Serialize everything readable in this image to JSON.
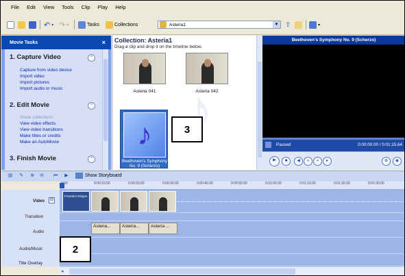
{
  "menu": [
    "File",
    "Edit",
    "View",
    "Tools",
    "Clip",
    "Play",
    "Help"
  ],
  "toolbar": {
    "tasks_label": "Tasks",
    "collections_label": "Collections",
    "collection_value": "Asteria1"
  },
  "tasks_pane": {
    "title": "Movie Tasks",
    "close": "×",
    "sections": [
      {
        "title": "1. Capture Video",
        "links": [
          "Capture from video device",
          "Import video",
          "Import pictures",
          "Import audio or music"
        ]
      },
      {
        "title": "2. Edit Movie",
        "links": [
          "Show collections",
          "View video effects",
          "View video transitions",
          "Make titles or credits",
          "Make an AutoMovie"
        ]
      },
      {
        "title": "3. Finish Movie",
        "links": []
      }
    ]
  },
  "collection": {
    "title": "Collection: Asteria1",
    "instructions": "Drag a clip and drop it on the timeline below.",
    "clips": [
      {
        "caption": "Asteria 041"
      },
      {
        "caption": "Asteria 042"
      }
    ],
    "selected_audio": "Beethoven's Symphony No. 9 (Scherzo)"
  },
  "preview": {
    "title": "Beethoven's Symphony No. 9 (Scherzo)",
    "status": "Paused",
    "time": "0:00:00.00 / 0:01:15.64"
  },
  "timeline": {
    "show_storyboard": "Show Storyboard",
    "ruler": [
      "0:00",
      "0:00:10.00",
      "0:00:20.00",
      "0:00:30.00",
      "0:00:40.00",
      "0:00:50.00",
      "0:01:00.00",
      "0:01:10.00",
      "0:01:20.00",
      "0:01:30.00"
    ],
    "tracks": {
      "video": "Video",
      "video_badge": "⊟",
      "transition": "Transition",
      "audio": "Audio",
      "audio_music": "Audio/Music",
      "title_overlay": "Title Overlay"
    },
    "first_clip": "Freedom Reigns",
    "audio_clips": [
      "Asteria...",
      "Asteria...",
      "Asteria ..."
    ]
  },
  "callouts": {
    "three": "3",
    "two": "2"
  },
  "colors": {
    "accent": "#316ac5",
    "track": "#9db6ea",
    "header": "#0a49b4"
  }
}
